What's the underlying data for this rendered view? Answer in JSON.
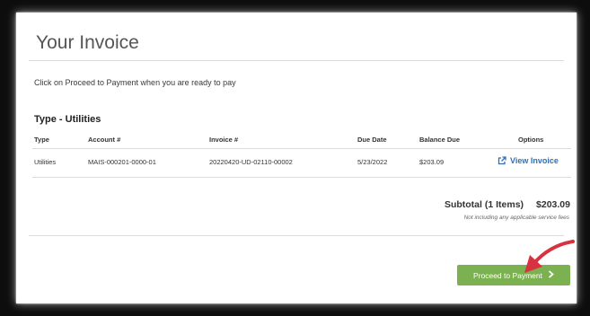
{
  "page": {
    "title": "Your Invoice",
    "instruction": "Click on Proceed to Payment when you are ready to pay"
  },
  "invoice": {
    "section_title": "Type - Utilities",
    "columns": [
      "Type",
      "Account #",
      "Invoice #",
      "Due Date",
      "Balance Due",
      "Options"
    ],
    "rows": [
      {
        "type": "Utilities",
        "account": "MAIS-000201-0000-01",
        "invoice": "20220420-UD-02110-00002",
        "due_date": "5/23/2022",
        "balance": "$203.09",
        "option_label": "View Invoice"
      }
    ]
  },
  "summary": {
    "subtotal_label": "Subtotal (1 Items)",
    "subtotal_amount": "$203.09",
    "fee_note": "Not including any applicable service fees"
  },
  "actions": {
    "proceed_label": "Proceed to Payment",
    "proceed_icon": "chevron-right-icon"
  },
  "colors": {
    "button": "#7cb151",
    "link": "#2f6fb8",
    "arrow": "#d8313f"
  },
  "icons": {
    "view_invoice": "external-link-icon"
  }
}
